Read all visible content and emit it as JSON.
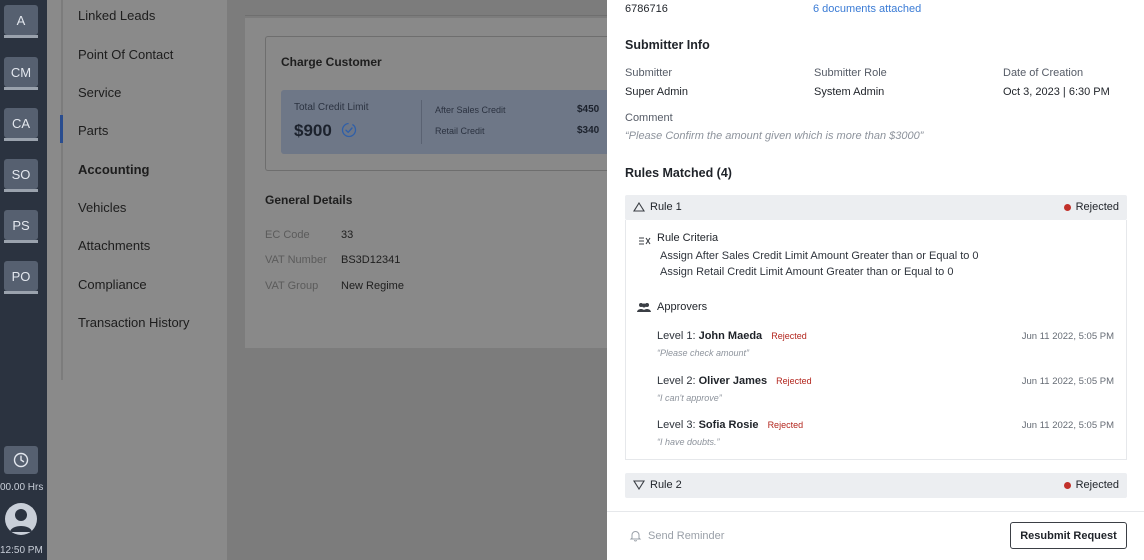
{
  "rail": {
    "buttons": [
      "A",
      "CM",
      "CA",
      "SO",
      "PS",
      "PO"
    ],
    "hours": "00.00 Hrs",
    "time": "12:50 PM"
  },
  "nav": {
    "items": [
      "Linked Leads",
      "Point Of Contact",
      "Service",
      "Parts",
      "Accounting",
      "Vehicles",
      "Attachments",
      "Compliance",
      "Transaction History"
    ]
  },
  "main": {
    "charge": {
      "title": "Charge Customer",
      "total_label": "Total Credit Limit",
      "total_value": "$900",
      "after_sales_label": "After Sales Credit",
      "after_sales_value": "$450",
      "retail_label": "Retail Credit",
      "retail_value": "$340"
    },
    "general": {
      "title": "General Details",
      "ec_label": "EC Code",
      "ec_value": "33",
      "vat_label": "VAT Number",
      "vat_value": "BS3D12341",
      "vatgroup_label": "VAT Group",
      "vatgroup_value": "New Regime"
    }
  },
  "panel": {
    "ref_number": "6786716",
    "documents_link": "6 documents attached",
    "submitter_heading": "Submitter Info",
    "submitter_label": "Submitter",
    "submitter_value": "Super Admin",
    "role_label": "Submitter Role",
    "role_value": "System Admin",
    "date_label": "Date of Creation",
    "date_value": "Oct 3, 2023 | 6:30 PM",
    "comment_label": "Comment",
    "comment_value": "“Please Confirm the amount given which is more than $3000”",
    "rules_heading": "Rules Matched (4)",
    "rule1": {
      "name": "Rule 1",
      "status": "Rejected",
      "criteria_heading": "Rule Criteria",
      "criteria": [
        "Assign After Sales Credit Limit Amount Greater than or Equal to 0",
        "Assign Retail Credit Limit Amount Greater than or Equal to 0"
      ],
      "approvers_heading": "Approvers",
      "approvers": [
        {
          "level": "Level 1:",
          "name": "John Maeda",
          "status": "Rejected",
          "date": "Jun 11 2022, 5:05 PM",
          "note": "“Please check amount”"
        },
        {
          "level": "Level 2:",
          "name": "Oliver James",
          "status": "Rejected",
          "date": "Jun 11 2022, 5:05 PM",
          "note": "“I can't approve”"
        },
        {
          "level": "Level 3:",
          "name": "Sofia Rosie",
          "status": "Rejected",
          "date": "Jun 11 2022, 5:05 PM",
          "note": "“I have doubts.”"
        }
      ]
    },
    "rule2": {
      "name": "Rule 2",
      "status": "Rejected"
    },
    "send_reminder": "Send Reminder",
    "resubmit": "Resubmit Request"
  }
}
